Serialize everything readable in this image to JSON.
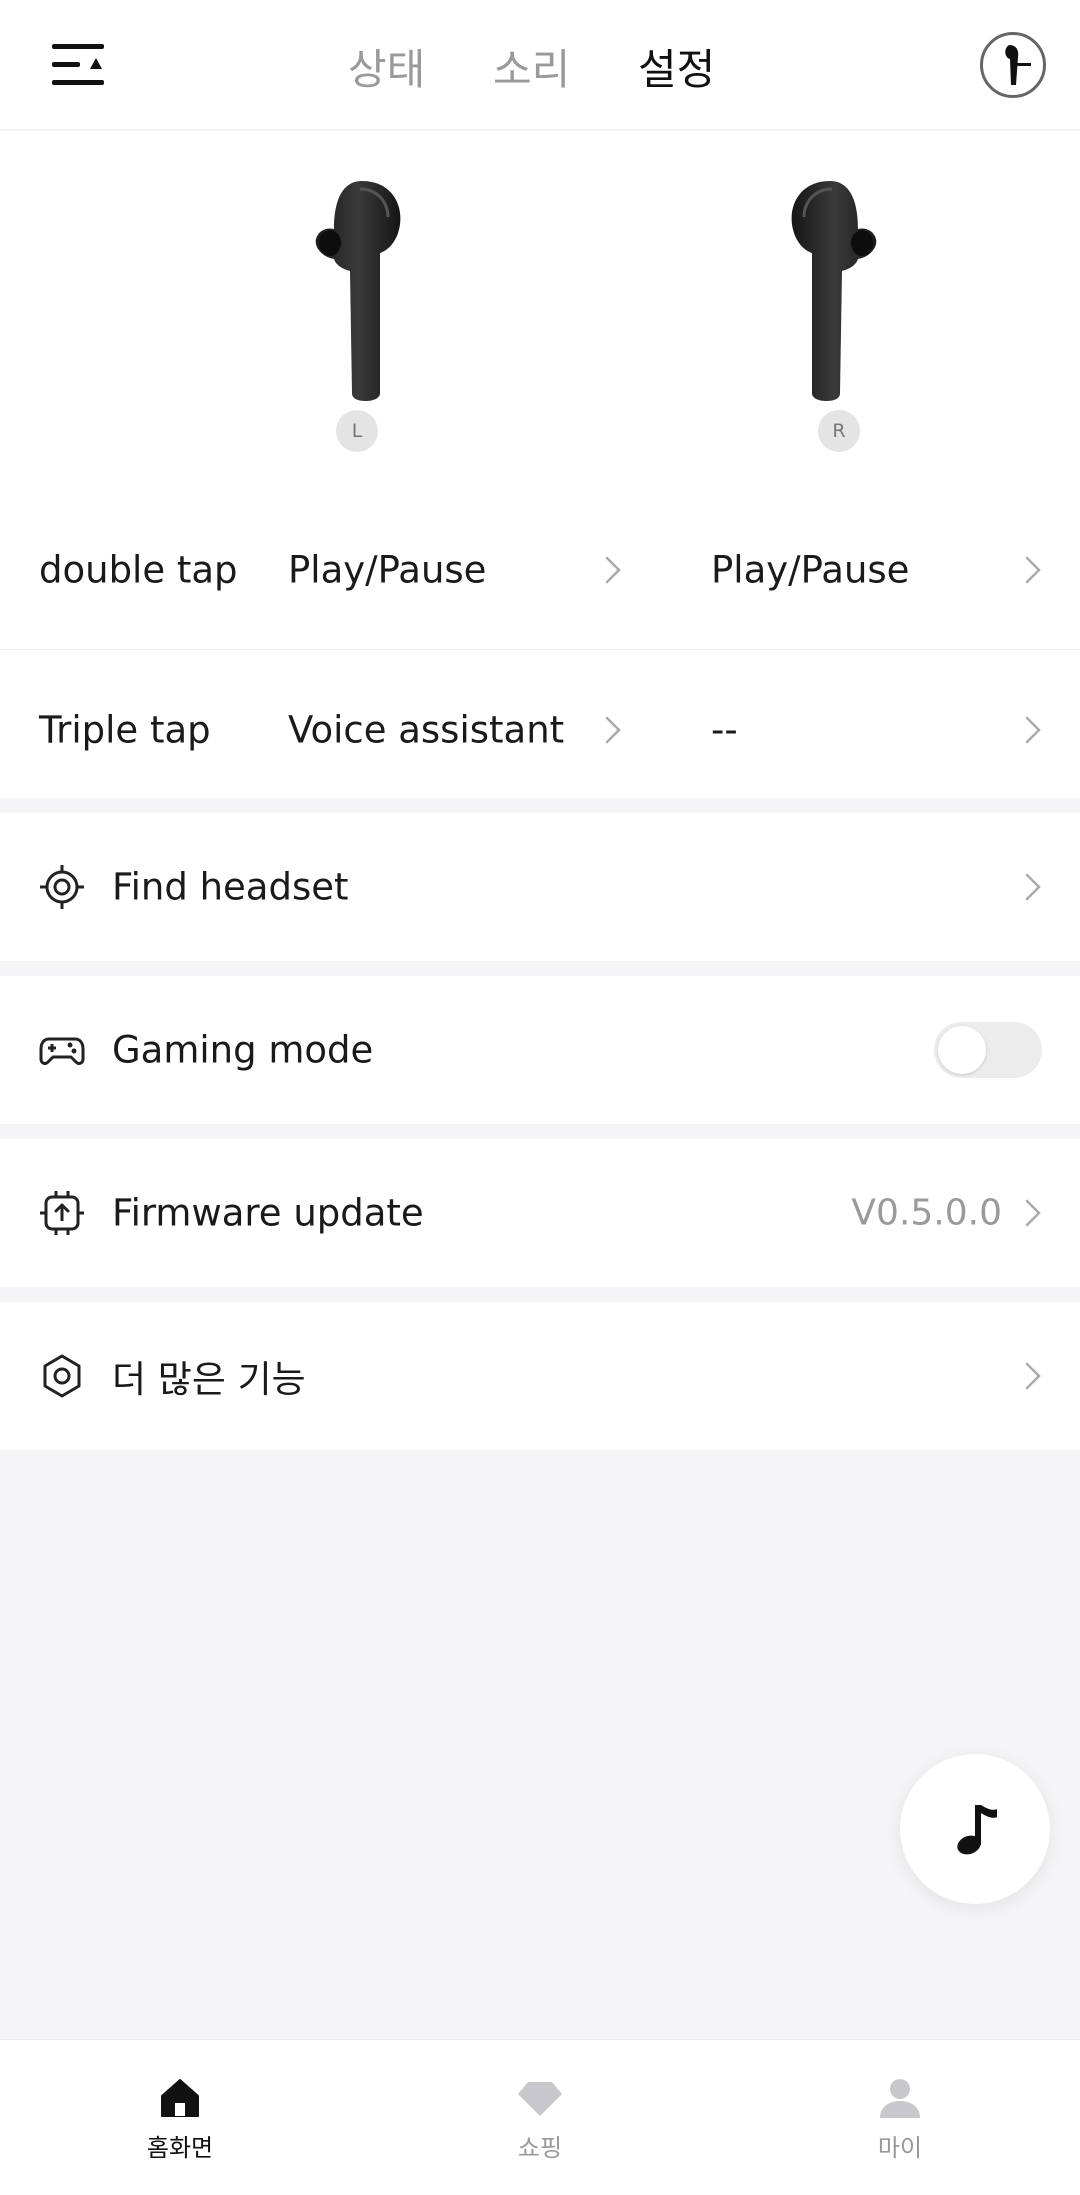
{
  "header": {
    "tabs": [
      {
        "label": "상태",
        "active": false
      },
      {
        "label": "소리",
        "active": false
      },
      {
        "label": "설정",
        "active": true
      }
    ]
  },
  "earbuds": {
    "left_badge": "L",
    "right_badge": "R"
  },
  "tap_settings": {
    "rows": [
      {
        "label": "double tap",
        "left_value": "Play/Pause",
        "right_value": "Play/Pause"
      },
      {
        "label": "Triple tap",
        "left_value": "Voice assistant",
        "right_value": "--"
      }
    ]
  },
  "settings_items": {
    "find_headset": {
      "label": "Find headset",
      "icon": "target-icon"
    },
    "gaming_mode": {
      "label": "Gaming mode",
      "icon": "gamepad-icon",
      "enabled": false
    },
    "firmware_update": {
      "label": "Firmware update",
      "icon": "chip-upload-icon",
      "version": "V0.5.0.0"
    },
    "more_features": {
      "label": "더 많은 기능",
      "icon": "hexagon-icon"
    }
  },
  "bottom_nav": {
    "items": [
      {
        "label": "홈화면",
        "icon": "home-icon",
        "active": true
      },
      {
        "label": "쇼핑",
        "icon": "diamond-icon",
        "active": false
      },
      {
        "label": "마이",
        "icon": "person-icon",
        "active": false
      }
    ]
  },
  "colors": {
    "background": "#f5f5f7",
    "surface": "#ffffff",
    "text_primary": "#1a1a1a",
    "text_secondary": "#9a9a9a"
  }
}
